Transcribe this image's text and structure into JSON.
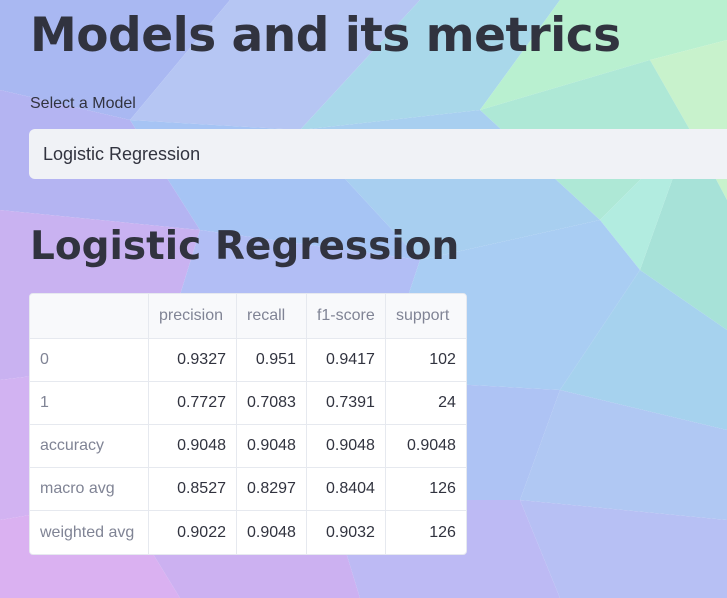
{
  "page": {
    "title": "Models and its metrics"
  },
  "model_select": {
    "label": "Select a Model",
    "selected": "Logistic Regression"
  },
  "section": {
    "title": "Logistic Regression"
  },
  "metrics_table": {
    "columns": [
      "",
      "precision",
      "recall",
      "f1-score",
      "support"
    ],
    "rows": [
      {
        "label": "0",
        "precision": "0.9327",
        "recall": "0.951",
        "f1": "0.9417",
        "support": "102"
      },
      {
        "label": "1",
        "precision": "0.7727",
        "recall": "0.7083",
        "f1": "0.7391",
        "support": "24"
      },
      {
        "label": "accuracy",
        "precision": "0.9048",
        "recall": "0.9048",
        "f1": "0.9048",
        "support": "0.9048"
      },
      {
        "label": "macro avg",
        "precision": "0.8527",
        "recall": "0.8297",
        "f1": "0.8404",
        "support": "126"
      },
      {
        "label": "weighted avg",
        "precision": "0.9022",
        "recall": "0.9048",
        "f1": "0.9032",
        "support": "126"
      }
    ]
  },
  "colors": {
    "text": "#31333f",
    "muted_text": "#808495",
    "select_bg": "#f0f2f6",
    "table_border": "#e6e9ef",
    "table_header_bg": "#f8f9fb"
  }
}
